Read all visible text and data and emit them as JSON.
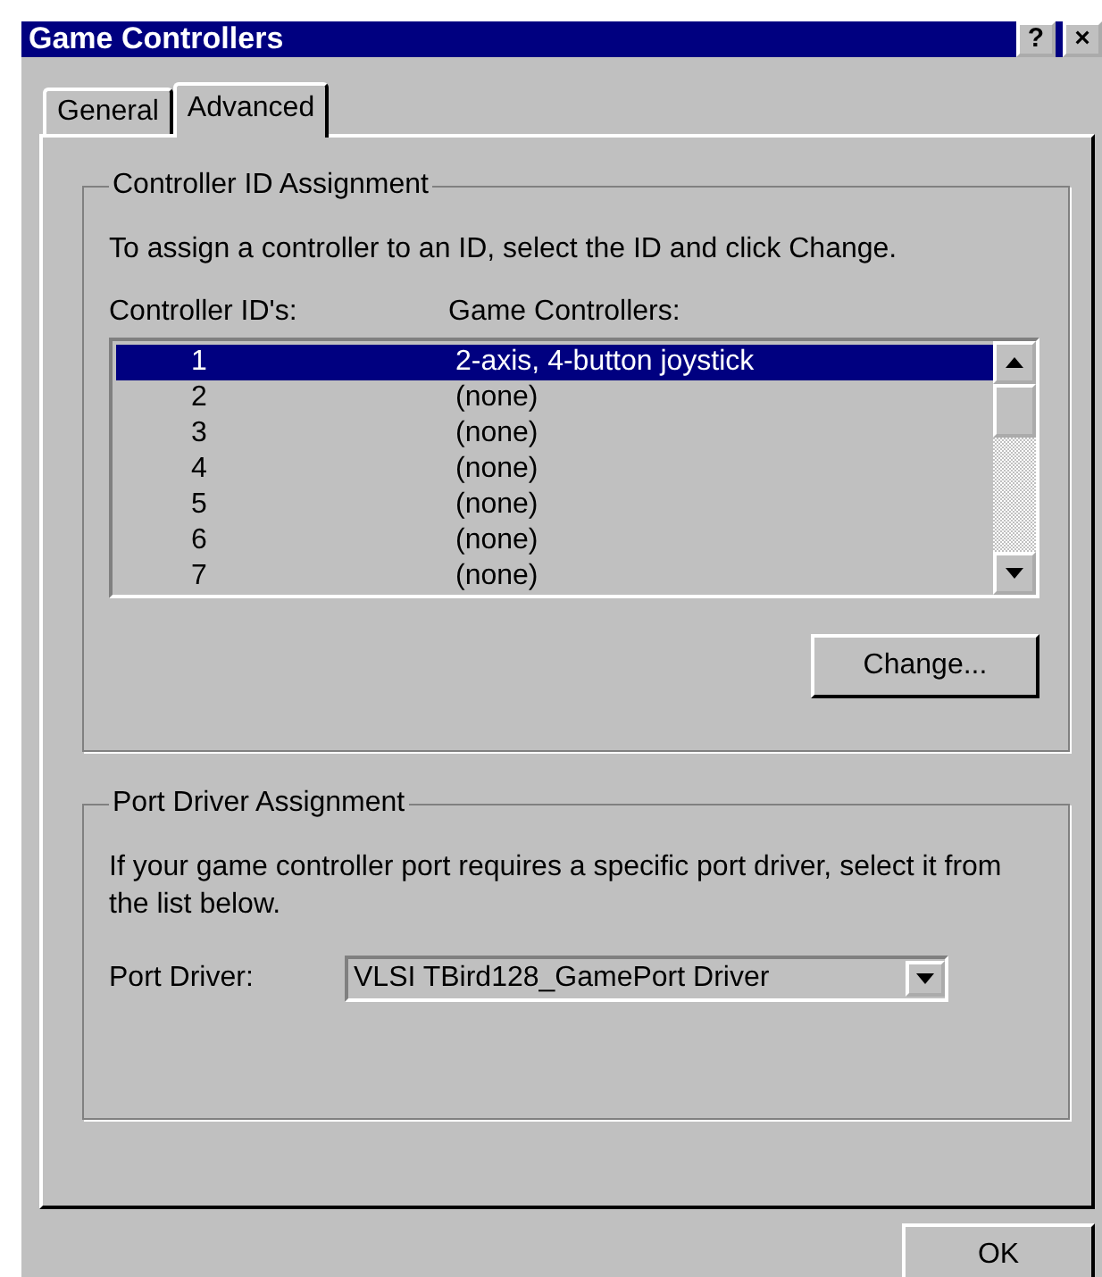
{
  "window": {
    "title": "Game Controllers",
    "title_buttons": [
      "?",
      "×"
    ]
  },
  "tabs": [
    {
      "label": "General",
      "selected": false
    },
    {
      "label": "Advanced",
      "selected": true
    }
  ],
  "controller_group": {
    "title": "Controller ID Assignment",
    "instructions": "To assign a controller to an ID, select the ID and click Change.",
    "columns": [
      "Controller ID's:",
      "Game Controllers:"
    ],
    "rows": [
      {
        "id": "1",
        "controller": "2-axis, 4-button joystick",
        "selected": true
      },
      {
        "id": "2",
        "controller": "(none)",
        "selected": false
      },
      {
        "id": "3",
        "controller": "(none)",
        "selected": false
      },
      {
        "id": "4",
        "controller": "(none)",
        "selected": false
      },
      {
        "id": "5",
        "controller": "(none)",
        "selected": false
      },
      {
        "id": "6",
        "controller": "(none)",
        "selected": false
      },
      {
        "id": "7",
        "controller": "(none)",
        "selected": false
      }
    ],
    "button": "Change..."
  },
  "port_group": {
    "title": "Port Driver Assignment",
    "description": "If your game controller port requires a specific port driver, select it from the list below.",
    "label": "Port Driver:",
    "value": "VLSI TBird128_GamePort Driver"
  },
  "buttons": [
    "OK"
  ]
}
